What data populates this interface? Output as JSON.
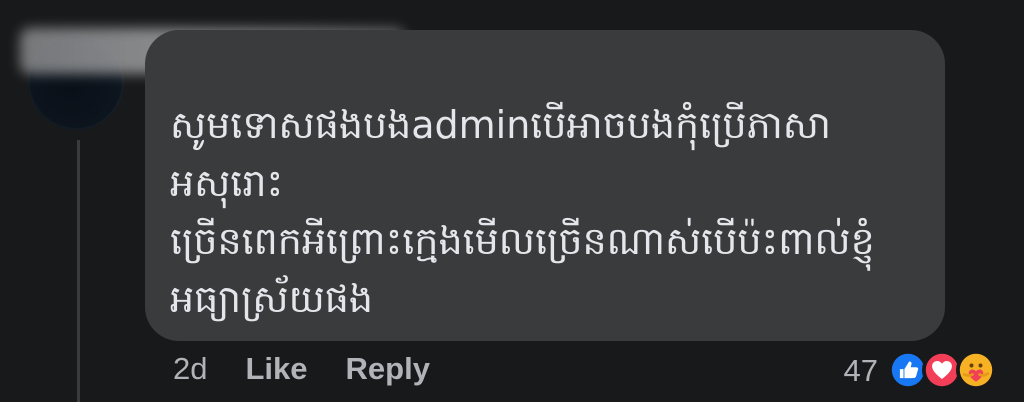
{
  "comment": {
    "text": "សូមទោសផងបងadminបើអាចបងកុំប្រើភាសាអសុរោះ\nច្រើនពេកអីព្រោះក្មេងមើលច្រើនណាស់បើប៉ះពាល់ខ្ញុំ\nអធ្យាស្រ័យផង",
    "time": "2d",
    "like_label": "Like",
    "reply_label": "Reply",
    "reaction_count": "47"
  },
  "reactions": [
    {
      "icon": "like-icon",
      "color": "#1877f2"
    },
    {
      "icon": "love-icon",
      "color": "#f33e58"
    },
    {
      "icon": "care-icon",
      "color": "#f7b125"
    }
  ]
}
